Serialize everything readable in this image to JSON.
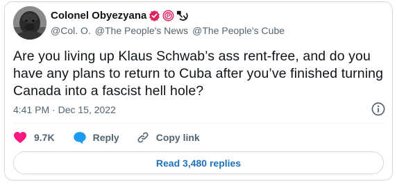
{
  "author": {
    "display_name": "Colonel Obyezyana",
    "handles": [
      "@Col. O.",
      "@The People's News",
      "@The People's Cube"
    ]
  },
  "tweet": {
    "text": "Are you living up Klaus Schwab’s ass rent-free, and do you have any plans to return to Cuba after you’ve finished turning Canada into a fascist hell hole?",
    "timestamp": "4:41 PM · Dec 15, 2022"
  },
  "actions": {
    "like_count": "9.7K",
    "reply_label": "Reply",
    "copy_link_label": "Copy link"
  },
  "read_replies_label": "Read 3,480 replies",
  "colors": {
    "like": "#f91880",
    "reply_bubble": "#1d9bf0",
    "link_text": "#1d71b8",
    "badge_red": "#e0245e",
    "secondary_text": "#536471"
  },
  "icons": [
    "avatar",
    "verified-badge-icon",
    "affiliate-badge-icon",
    "hammer-sickle-icon",
    "info-icon",
    "heart-icon",
    "speech-bubble-icon",
    "link-icon"
  ]
}
